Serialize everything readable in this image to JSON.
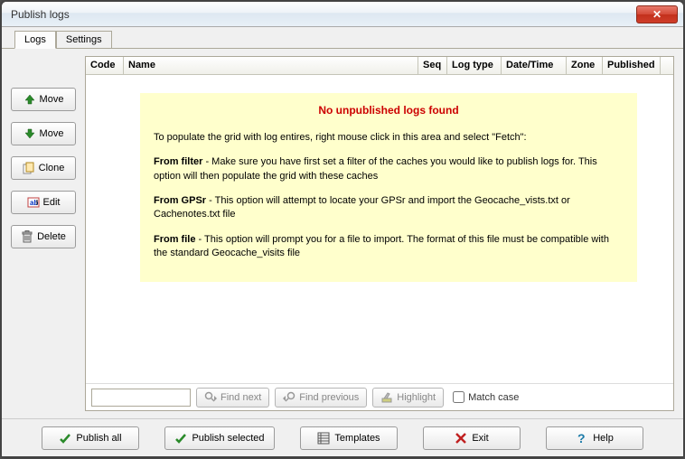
{
  "window": {
    "title": "Publish logs"
  },
  "tabs": {
    "logs": "Logs",
    "settings": "Settings"
  },
  "sidebar": {
    "move_up": "Move",
    "move_down": "Move",
    "clone": "Clone",
    "edit": "Edit",
    "delete": "Delete"
  },
  "grid": {
    "cols": {
      "code": "Code",
      "name": "Name",
      "seq": "Seq",
      "logtype": "Log type",
      "datetime": "Date/Time",
      "zone": "Zone",
      "published": "Published"
    }
  },
  "info": {
    "title": "No unpublished logs found",
    "intro": "To populate the grid with log entires, right mouse click in this area and select \"Fetch\":",
    "filter_bold": "From filter",
    "filter_rest": " - Make sure you have first set a filter of the caches you would like to publish logs for. This option will then populate the grid with these caches",
    "gpsr_bold": "From GPSr",
    "gpsr_rest": " - This option will attempt to locate your GPSr and import the Geocache_vists.txt or Cachenotes.txt file",
    "file_bold": "From file",
    "file_rest": " - This option will prompt you for a file to import. The format of this file must be compatible with the standard Geocache_visits file"
  },
  "search": {
    "find_next": "Find next",
    "find_prev": "Find previous",
    "highlight": "Highlight",
    "match_case": "Match case"
  },
  "footer": {
    "publish_all": "Publish all",
    "publish_selected": "Publish selected",
    "templates": "Templates",
    "exit": "Exit",
    "help": "Help"
  }
}
